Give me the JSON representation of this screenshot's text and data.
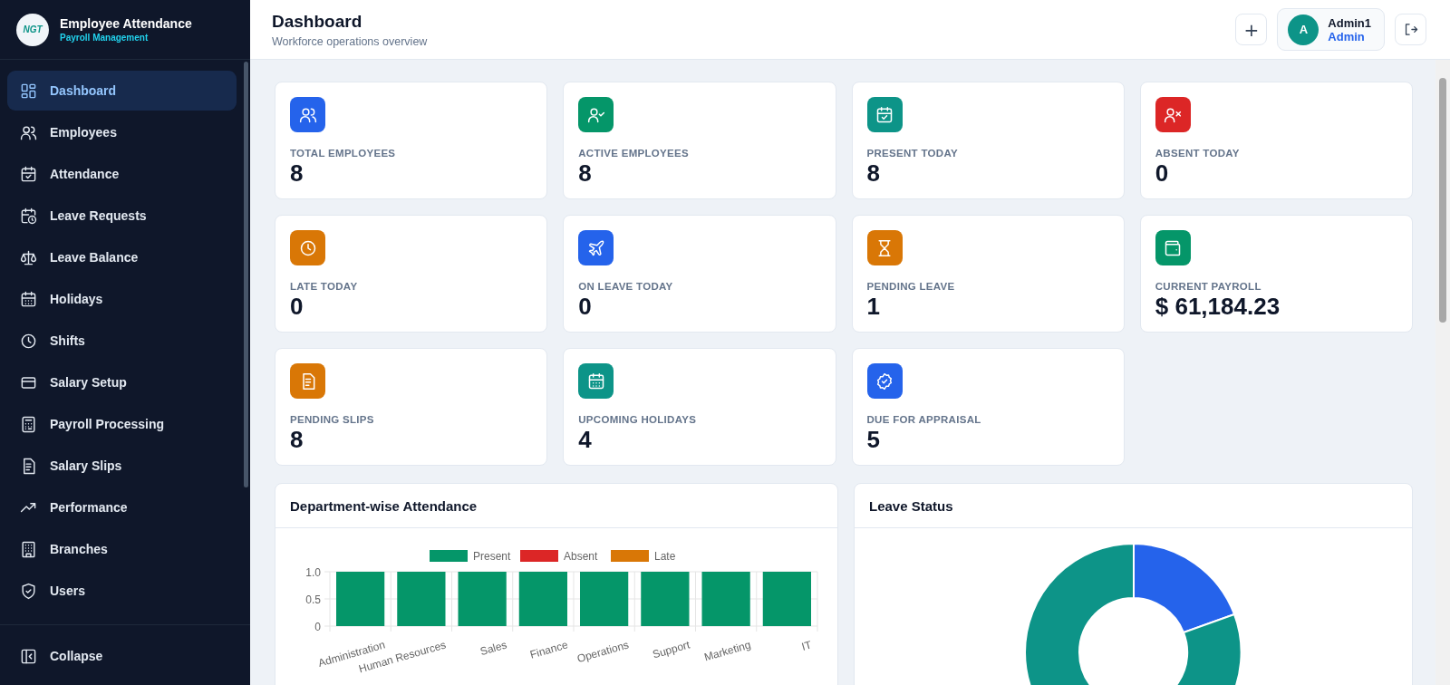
{
  "brand": {
    "logo_text": "NGT",
    "title": "Employee Attendance",
    "subtitle": "Payroll Management"
  },
  "sidebar": {
    "items": [
      {
        "label": "Dashboard",
        "selected": true
      },
      {
        "label": "Employees",
        "selected": false
      },
      {
        "label": "Attendance",
        "selected": false
      },
      {
        "label": "Leave Requests",
        "selected": false
      },
      {
        "label": "Leave Balance",
        "selected": false
      },
      {
        "label": "Holidays",
        "selected": false
      },
      {
        "label": "Shifts",
        "selected": false
      },
      {
        "label": "Salary Setup",
        "selected": false
      },
      {
        "label": "Payroll Processing",
        "selected": false
      },
      {
        "label": "Salary Slips",
        "selected": false
      },
      {
        "label": "Performance",
        "selected": false
      },
      {
        "label": "Branches",
        "selected": false
      },
      {
        "label": "Users",
        "selected": false
      }
    ],
    "collapse": "Collapse"
  },
  "header": {
    "title": "Dashboard",
    "subtitle": "Workforce operations overview",
    "add_button": "+",
    "user": {
      "avatar": "A",
      "name": "Admin1",
      "role": "Admin"
    }
  },
  "stats": [
    {
      "label": "TOTAL EMPLOYEES",
      "value": "8",
      "color": "#2563eb"
    },
    {
      "label": "ACTIVE EMPLOYEES",
      "value": "8",
      "color": "#059669"
    },
    {
      "label": "PRESENT TODAY",
      "value": "8",
      "color": "#0d9488"
    },
    {
      "label": "ABSENT TODAY",
      "value": "0",
      "color": "#dc2626"
    },
    {
      "label": "LATE TODAY",
      "value": "0",
      "color": "#d97706"
    },
    {
      "label": "ON LEAVE TODAY",
      "value": "0",
      "color": "#2563eb"
    },
    {
      "label": "PENDING LEAVE",
      "value": "1",
      "color": "#d97706"
    },
    {
      "label": "CURRENT PAYROLL",
      "value": "$ 61,184.23",
      "color": "#059669"
    },
    {
      "label": "PENDING SLIPS",
      "value": "8",
      "color": "#d97706"
    },
    {
      "label": "UPCOMING HOLIDAYS",
      "value": "4",
      "color": "#0d9488"
    },
    {
      "label": "DUE FOR APPRAISAL",
      "value": "5",
      "color": "#2563eb"
    }
  ],
  "attendance_panel": {
    "title": "Department-wise Attendance",
    "chart_data": {
      "type": "bar",
      "stacked": true,
      "categories": [
        "Administration",
        "Human Resources",
        "Sales",
        "Finance",
        "Operations",
        "Support",
        "Marketing",
        "IT"
      ],
      "series": [
        {
          "name": "Present",
          "color": "#059669",
          "values": [
            1,
            1,
            1,
            1,
            1,
            1,
            1,
            1
          ]
        },
        {
          "name": "Absent",
          "color": "#dc2626",
          "values": [
            0,
            0,
            0,
            0,
            0,
            0,
            0,
            0
          ]
        },
        {
          "name": "Late",
          "color": "#d97706",
          "values": [
            0,
            0,
            0,
            0,
            0,
            0,
            0,
            0
          ]
        }
      ],
      "ylim": [
        0,
        1
      ],
      "yticks": [
        {
          "value": 0,
          "label": "0"
        },
        {
          "value": 0.5,
          "label": "0.5"
        },
        {
          "value": 1,
          "label": "1.0"
        }
      ]
    }
  },
  "leave_panel": {
    "title": "Leave Status"
  }
}
